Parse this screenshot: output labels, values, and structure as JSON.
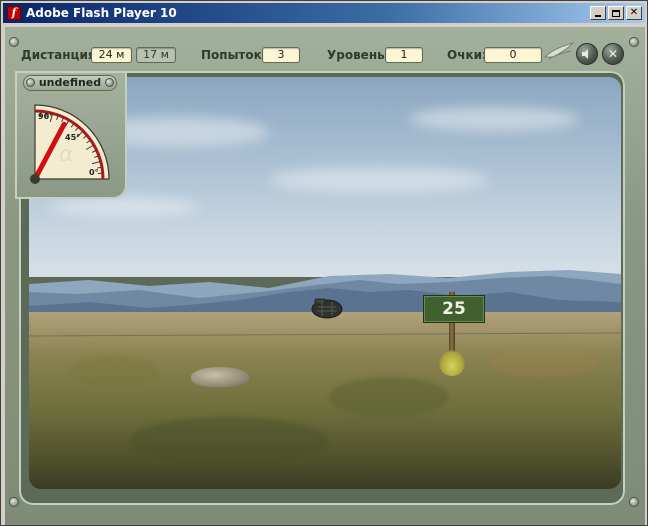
{
  "window": {
    "title": "Adobe Flash Player 10",
    "icon": "flash-icon",
    "controls": [
      "minimize-icon",
      "maximize-icon",
      "close-icon"
    ]
  },
  "hud": {
    "distance_label": "Дистанция:",
    "distance_value": "24 м",
    "distance_secondary": "17 м",
    "attempts_label": "Попыток:",
    "attempts_value": "3",
    "level_label": "Уровень:",
    "level_value": "1",
    "score_label": "Очки:",
    "score_value": "0",
    "sound_icon": "speaker-icon",
    "exit_icon": "close-icon"
  },
  "gauge": {
    "label": "undefined",
    "mark_90": "90°",
    "mark_45": "45°",
    "mark_0": "0°",
    "alpha": "α",
    "angle_deg": 62
  },
  "scene": {
    "target_sign": "25",
    "colors": {
      "frame": "#8d9b86",
      "sign": "#41602f",
      "needle": "#d01010"
    }
  }
}
